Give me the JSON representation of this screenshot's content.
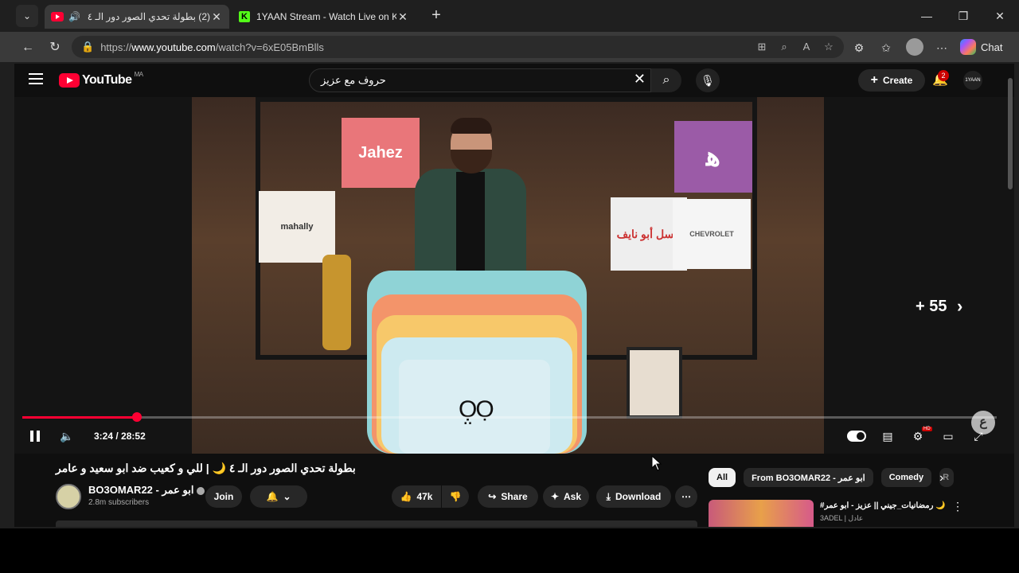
{
  "browser": {
    "tabs": [
      {
        "title": "(2) بطولة تحدي الصور دور الـ ٤ 🌙",
        "active": true
      },
      {
        "title": "1YAAN Stream - Watch Live on Kick",
        "active": false
      }
    ],
    "url_prefix": "https://",
    "url_host": "www.youtube.com",
    "url_path": "/watch?v=6xE05BmBlls",
    "chat_label": "Chat"
  },
  "youtube": {
    "logo_text": "YouTube",
    "country_code": "MA",
    "search_value": "حروف مع عزيز",
    "create_label": "Create",
    "notification_count": "2",
    "avatar_text": "1YAAN"
  },
  "player": {
    "current_time": "3:24",
    "duration": "28:52",
    "progress_fraction": 0.118,
    "overlay_count": "+ 55",
    "video_signs": {
      "sign1": "Jahez",
      "sign2": "mahally",
      "sign3": "CHEVROLET",
      "sign4": "عسل أبو نايف"
    }
  },
  "video": {
    "title": "بطولة تحدي الصور دور الـ ٤ 🌙 | للي و كعيب ضد ابو سعيد و عامر",
    "channel_name": "BO3OMAR22 - ابو عمر",
    "subscribers": "2.8m subscribers",
    "join_label": "Join",
    "likes": "47k",
    "share_label": "Share",
    "ask_label": "Ask",
    "download_label": "Download"
  },
  "sidebar": {
    "chips": [
      "All",
      "From BO3OMAR22 - ابو عمر",
      "Comedy",
      "R"
    ],
    "rec_title": "#رمضانيات_جيني || عزيز - ابو عمر 🌙",
    "rec_channel": "3ADEL | عادل"
  },
  "colors": {
    "accent": "#ff0033",
    "bg": "#0f0f0f"
  }
}
